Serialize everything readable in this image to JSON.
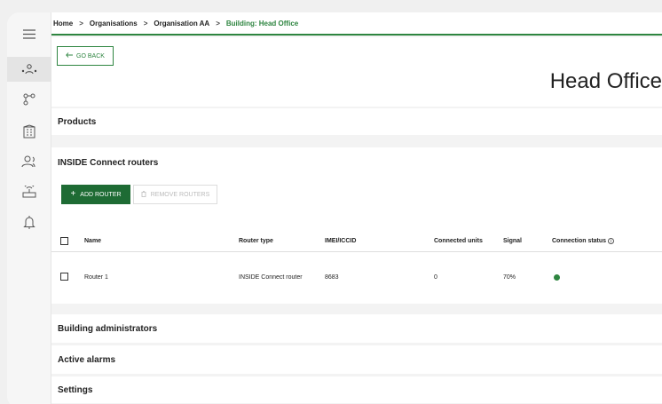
{
  "breadcrumb": {
    "items": [
      "Home",
      "Organisations",
      "Organisation AA"
    ],
    "current": "Building: Head Office",
    "separator": ">"
  },
  "header": {
    "go_back_label": "GO BACK",
    "title": "Head Office"
  },
  "sections": {
    "products": "Products",
    "building_admins": "Building administrators",
    "active_alarms": "Active alarms",
    "settings": "Settings"
  },
  "routers": {
    "title": "INSIDE Connect routers",
    "add_label": "ADD ROUTER",
    "remove_label": "REMOVE ROUTERS",
    "columns": [
      "Name",
      "Router type",
      "IMEI/ICCID",
      "Connected units",
      "Signal",
      "Connection status"
    ],
    "rows": [
      {
        "name": "Router 1",
        "type": "INSIDE Connect router",
        "imei": "8683",
        "units": "0",
        "signal": "70%",
        "status": "connected"
      }
    ]
  },
  "colors": {
    "accent": "#2e8540",
    "button_dark": "#1e6b34"
  }
}
